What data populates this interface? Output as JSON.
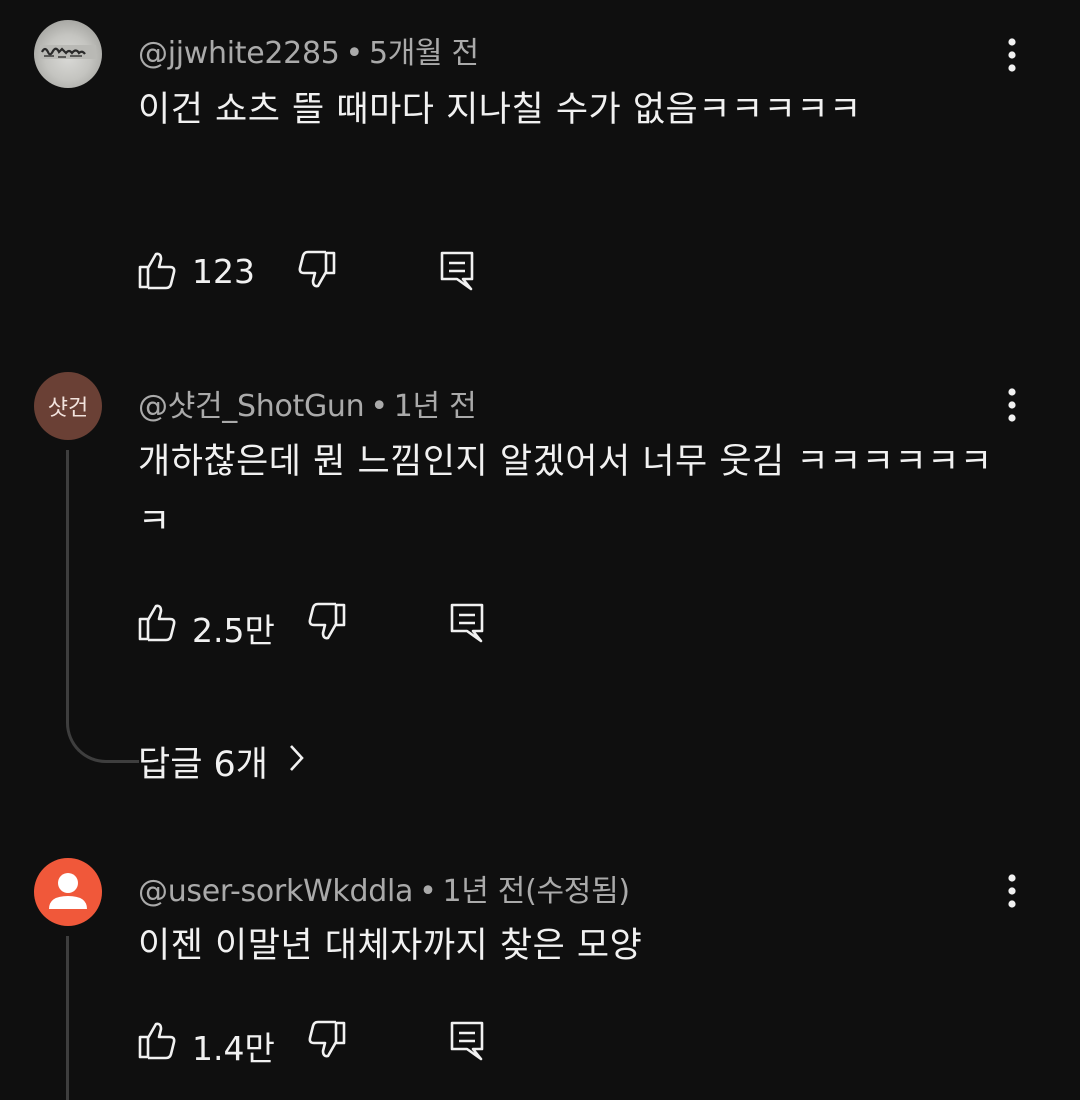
{
  "comments": [
    {
      "handle": "@jjwhite2285",
      "time": "5개월 전",
      "text": "이건 쇼츠 뜰 때마다 지나칠 수가 없음ㅋㅋㅋㅋㅋ",
      "likes": "123",
      "avatar": "photo"
    },
    {
      "handle": "@샷건_ShotGun",
      "time": "1년 전",
      "text": "개하찮은데 뭔 느낌인지 알겠어서 너무 웃김 ㅋㅋㅋㅋㅋㅋㅋ",
      "likes": "2.5만",
      "avatar_text": "샷건",
      "replies_label": "답글 6개"
    },
    {
      "handle": "@user-sorkWkddla",
      "time": "1년 전(수정됨)",
      "text": "이젠 이말년 대체자까지 찾은 모양",
      "likes": "1.4만",
      "avatar": "default"
    }
  ],
  "separator": "•",
  "icons": {
    "like": "thumbs-up-icon",
    "dislike": "thumbs-down-icon",
    "reply": "reply-icon",
    "menu": "more-vert-icon",
    "chevron": "chevron-right-icon"
  },
  "colors": {
    "background": "#0f0f0f",
    "text_primary": "#f1f1f1",
    "text_secondary": "#aaaaaa",
    "default_avatar": "#f0583a",
    "initial_avatar": "#6a4035"
  }
}
